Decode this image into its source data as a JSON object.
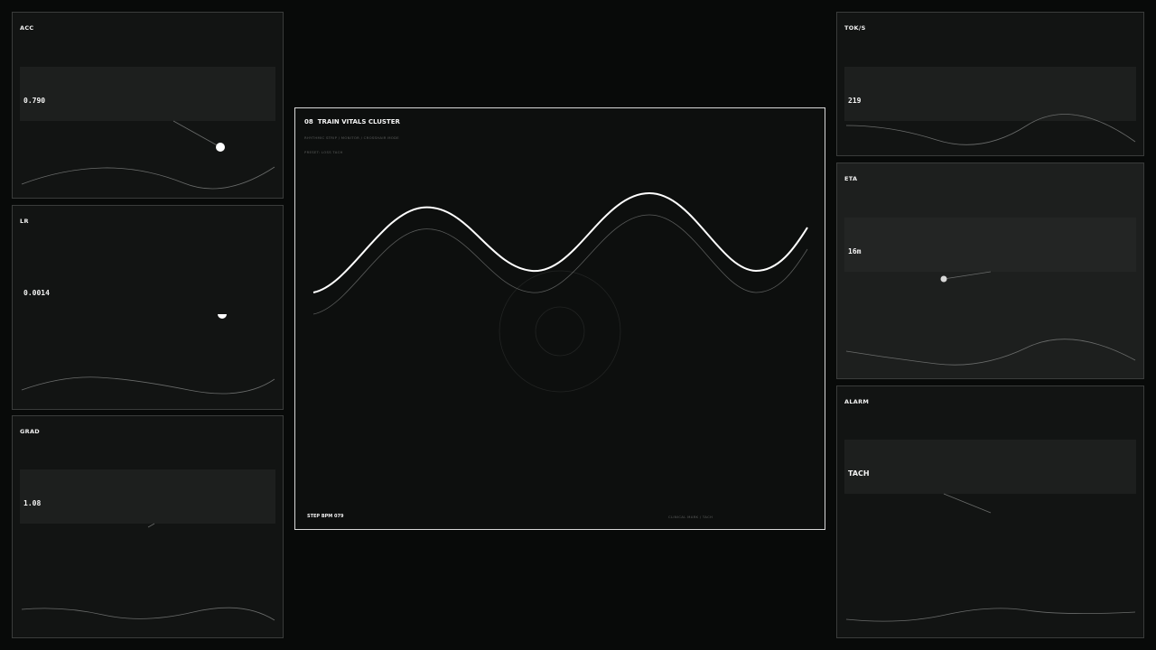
{
  "panels": {
    "acc": {
      "label": "ACC",
      "value": "0.790"
    },
    "lr": {
      "label": "LR",
      "value": "0.0014"
    },
    "grad": {
      "label": "GRAD",
      "value": "1.08"
    },
    "toks": {
      "label": "TOK/S",
      "value": "219"
    },
    "eta": {
      "label": "ETA",
      "value": "16m"
    },
    "alarm": {
      "label": "ALARM",
      "value": "TACH"
    }
  },
  "main": {
    "number": "08",
    "title": "TRAIN VITALS CLUSTER",
    "subtitle": "RHYTHMIC STRIP / MONITOR / CROSSHAIR MODE",
    "preset": "PRESET: LOSS TACH",
    "step": "STEP BPM 079",
    "footer_right": "CLINICAL MARK / TACH"
  },
  "colors": {
    "background": "#080a09",
    "panel": "#121413",
    "band": "#1d1f1e",
    "accent": "#ffffff",
    "muted": "#5c5e5d"
  }
}
